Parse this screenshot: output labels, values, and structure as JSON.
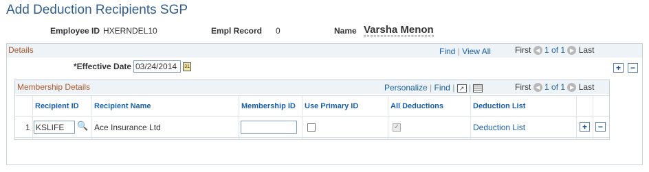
{
  "page": {
    "title": "Add Deduction Recipients SGP"
  },
  "header": {
    "employee_id_label": "Employee ID",
    "employee_id_value": "HXERNDEL10",
    "empl_record_label": "Empl Record",
    "empl_record_value": "0",
    "name_label": "Name",
    "name_value": "Varsha Menon"
  },
  "details": {
    "title": "Details",
    "find": "Find",
    "sep": "|",
    "view_all": "View All",
    "first": "First",
    "page_count": "1 of 1",
    "last": "Last",
    "effective_date_label": "*Effective Date",
    "effective_date_value": "03/24/2014"
  },
  "membership": {
    "title": "Membership Details",
    "personalize": "Personalize",
    "find": "Find",
    "sep": "|",
    "first": "First",
    "page_count": "1 of 1",
    "last": "Last",
    "columns": [
      "Recipient ID",
      "Recipient Name",
      "Membership ID",
      "Use Primary ID",
      "All Deductions",
      "Deduction List"
    ],
    "rows": [
      {
        "row_num": "1",
        "recipient_id": "KSLIFE",
        "recipient_name": "Ace Insurance Ltd",
        "membership_id": "",
        "use_primary_id": false,
        "all_deductions": true,
        "deduction_list": "Deduction List"
      }
    ]
  },
  "buttons": {
    "add": "+",
    "remove": "−"
  },
  "icons": {
    "prev": "arrow-left-icon",
    "next": "arrow-right-icon",
    "calendar": "calendar-icon",
    "search": "lookup-search-icon",
    "zoom": "zoom-icon",
    "download": "download-grid-icon"
  },
  "colors": {
    "title": "#305d8c",
    "link": "#1a5fa8",
    "box_title": "#b0572b",
    "header_band": "#eef3f7"
  }
}
